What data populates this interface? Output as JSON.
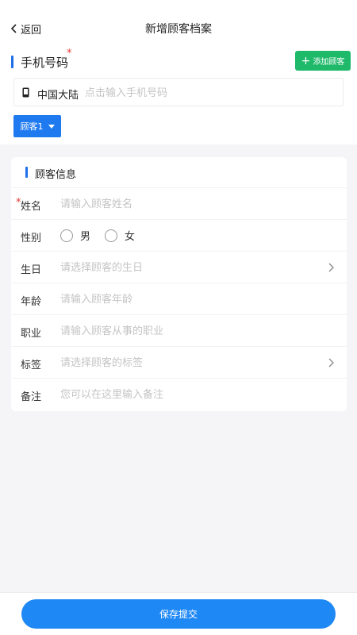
{
  "header": {
    "back_label": "返回",
    "title": "新增顾客档案"
  },
  "phone_section": {
    "label": "手机号码",
    "required_mark": "*",
    "add_button_label": "添加顾客",
    "region": "中国大陆",
    "phone_placeholder": "点击输入手机号码",
    "phone_value": "",
    "customer_tab_label": "顾客1"
  },
  "info_card": {
    "title": "顾客信息",
    "name": {
      "label": "姓名",
      "required_mark": "*",
      "placeholder": "请输入顾客姓名",
      "value": ""
    },
    "gender": {
      "label": "性别",
      "options": [
        "男",
        "女"
      ]
    },
    "birthday": {
      "label": "生日",
      "placeholder": "请选择顾客的生日",
      "value": ""
    },
    "age": {
      "label": "年龄",
      "placeholder": "请输入顾客年龄",
      "value": ""
    },
    "occupation": {
      "label": "职业",
      "placeholder": "请输入顾客从事的职业",
      "value": ""
    },
    "tags": {
      "label": "标签",
      "placeholder": "请选择顾客的标签",
      "value": ""
    },
    "remarks": {
      "label": "备注",
      "placeholder": "您可以在这里输入备注",
      "value": ""
    }
  },
  "bottom": {
    "submit_label": "保存提交"
  },
  "colors": {
    "accent_blue": "#1f7af0",
    "add_green": "#1fb96a",
    "required_red": "#e53935",
    "submit_blue": "#1e88f5"
  }
}
